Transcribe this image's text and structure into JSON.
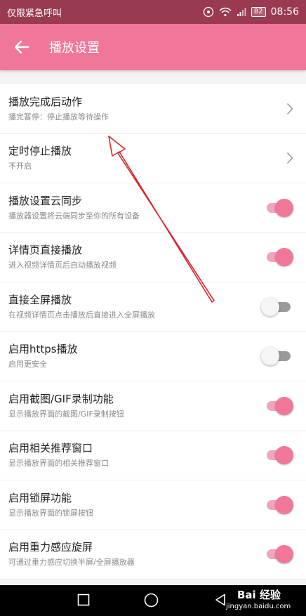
{
  "status_bar": {
    "carrier": "仅限紧急呼叫",
    "battery": "82",
    "time": "08:56"
  },
  "app_bar": {
    "title": "播放设置"
  },
  "settings": [
    {
      "title": "播放完成后动作",
      "subtitle": "播完暂停：停止播放等待操作",
      "control": "chevron"
    },
    {
      "title": "定时停止播放",
      "subtitle": "不开启",
      "control": "chevron"
    },
    {
      "title": "播放设置云同步",
      "subtitle": "播放器设置将云端同步至你的所有设备",
      "control": "toggle",
      "enabled": true
    },
    {
      "title": "详情页直接播放",
      "subtitle": "进入视频详情页后自动播放视频",
      "control": "toggle",
      "enabled": true
    },
    {
      "title": "直接全屏播放",
      "subtitle": "在视频详情页点击播放后直接进入全屏播放",
      "control": "toggle",
      "enabled": false
    },
    {
      "title": "启用https播放",
      "subtitle": "启用更安全",
      "control": "toggle",
      "enabled": false
    },
    {
      "title": "启用截图/GIF录制功能",
      "subtitle": "显示播放界面的截图/GIF录制按钮",
      "control": "toggle",
      "enabled": true
    },
    {
      "title": "启用相关推荐窗口",
      "subtitle": "显示播放界面的相关推荐窗口",
      "control": "toggle",
      "enabled": true
    },
    {
      "title": "启用锁屏功能",
      "subtitle": "显示播放界面的锁屏按钮",
      "control": "toggle",
      "enabled": true
    },
    {
      "title": "启用重力感应旋屏",
      "subtitle": "可通过重力感应切换半屏/全屏播放器",
      "control": "toggle",
      "enabled": true
    }
  ],
  "watermark": {
    "brand": "Bai 经验",
    "url": "jingyan.baidu.com"
  },
  "colors": {
    "accent": "#f0779a",
    "status_bar": "#9a3a50",
    "annotation_arrow": "#d9252b"
  }
}
